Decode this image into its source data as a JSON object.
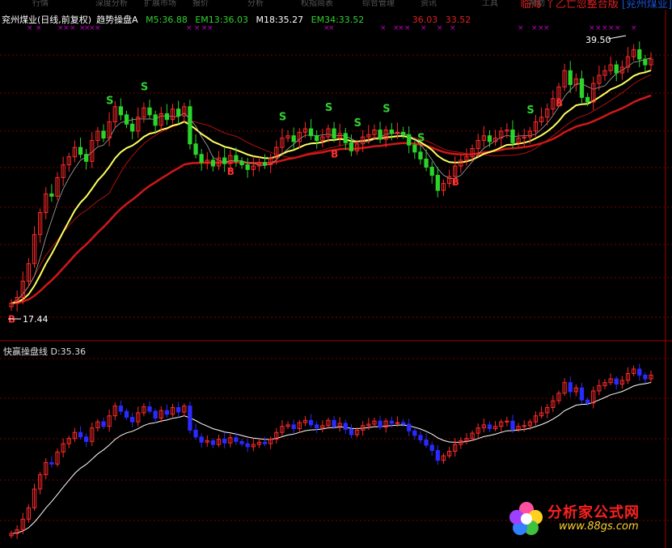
{
  "topbar": {
    "menu_items": [
      "行情",
      "深度分析",
      "扩展市场",
      "报价",
      "分析",
      "权指简表",
      "综合管理",
      "资讯",
      "工具",
      "帮助"
    ],
    "promo_prefix": "临海",
    "promo_main": "丫乙亡忽整合版",
    "promo_stock": "[兖州煤业]"
  },
  "main_legend": {
    "title": "兖州煤业(日线,前复权)",
    "indicator": "趋势操盘A",
    "m5": "M5:36.88",
    "em13": "EM13:36.03",
    "m18": "M18:35.27",
    "em34": "EM34:33.52",
    "extra1": "36.03",
    "extra2": "33.52",
    "colors": {
      "m5": "#30d030",
      "em13": "#30d030",
      "m18": "#ffffff",
      "em34": "#30d030",
      "extra": "#e02020"
    }
  },
  "sub_legend": {
    "name": "快赢操盘线",
    "value": "D:35.36"
  },
  "annotations": {
    "high_label": "39.50",
    "low_label": "17.44",
    "s_mark": "S",
    "b_mark": "B",
    "x_mark": "×"
  },
  "logo": {
    "text": "分析家公式网",
    "url": "www.88gs.com"
  },
  "colors": {
    "up": "#ff2a2a",
    "down": "#2ad42a",
    "sub_down": "#2a2aff",
    "ma_yellow": "#ffff60",
    "ma_red": "#d01818",
    "ma_white": "#ffffff",
    "grid": "#7a0000",
    "s_mark": "#30d030",
    "b_mark": "#ff3030",
    "x_mark": "#c000c0"
  },
  "chart_data": [
    {
      "type": "candlestick",
      "title": "兖州煤业(日线,前复权)",
      "ylim": [
        15.5,
        42
      ],
      "close": [
        17.6,
        18.1,
        19.5,
        21,
        23.5,
        25.4,
        27,
        26.8,
        28.4,
        29.5,
        30.2,
        31,
        30.4,
        29.8,
        31.6,
        32.4,
        31.8,
        33.2,
        34.5,
        33.8,
        33,
        32.4,
        33.6,
        34.4,
        33.8,
        32.9,
        33.9,
        33.4,
        34.3,
        33.7,
        34.5,
        31.3,
        30.4,
        29.7,
        29.9,
        29.4,
        30.1,
        29.6,
        30.3,
        29.8,
        29.5,
        29.1,
        29.4,
        29.7,
        29.5,
        30.1,
        31,
        31.8,
        32,
        31.5,
        32.3,
        32.6,
        32,
        31.6,
        31.9,
        32.6,
        31.8,
        32.2,
        31.4,
        30.7,
        31.3,
        31.9,
        32.1,
        32.5,
        31.7,
        32.5,
        32.2,
        32.3,
        32.1,
        31.2,
        30.6,
        30,
        29.3,
        28.6,
        27.3,
        27.9,
        28.5,
        29.4,
        29.9,
        30.2,
        30.9,
        31.6,
        32,
        31.5,
        31.8,
        32.4,
        32.5,
        31.4,
        31.8,
        31.9,
        32.4,
        33.2,
        33.6,
        34.3,
        35.2,
        36.2,
        37.6,
        36.4,
        36.9,
        35.3,
        34.9,
        36.5,
        37.2,
        37.6,
        38.1,
        37.4,
        37.9,
        38.8,
        39.4,
        38.6,
        38.1,
        38.6
      ],
      "series": [
        {
          "name": "M5",
          "label": "M5:36.88"
        },
        {
          "name": "EM13",
          "label": "EM13:36.03"
        },
        {
          "name": "M18",
          "label": "M18:35.27"
        },
        {
          "name": "EM34",
          "label": "EM34:33.52"
        }
      ],
      "high_marker": 39.5,
      "low_marker": 17.44
    },
    {
      "type": "candlestick",
      "title": "快赢操盘线",
      "value_label": "D:35.36",
      "ylim": [
        15.5,
        42
      ]
    }
  ]
}
